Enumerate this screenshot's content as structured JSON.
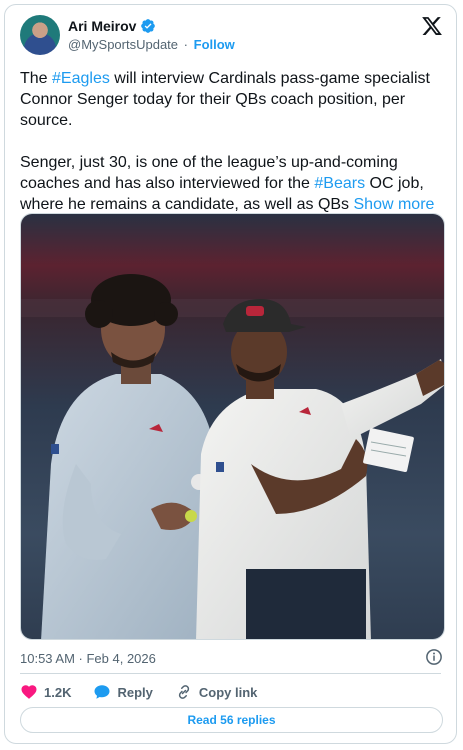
{
  "author": {
    "name": "Ari Meirov",
    "handle": "@MySportsUpdate",
    "separator": "·",
    "follow_label": "Follow"
  },
  "tweet": {
    "p1": {
      "t1": "The ",
      "hashtag": "#Eagles",
      "t2": " will interview Cardinals pass-game specialist Connor Senger today for their QBs coach position, per source."
    },
    "p2": {
      "t1": "Senger, just 30, is one of the league’s up-and-coming coaches and has also interviewed for the ",
      "hashtag": "#Bears",
      "t2": " OC job, where he remains a candidate, as well as QBs ",
      "show_more": "Show more"
    },
    "timestamp": "10:53 AM · Feb 4, 2026"
  },
  "actions": {
    "likes": "1.2K",
    "reply_label": "Reply",
    "copy_label": "Copy link"
  },
  "read_replies_label": "Read 56 replies",
  "icons": {
    "verified": "verified-badge-icon",
    "brand": "x-logo-icon",
    "info": "info-icon",
    "like": "heart-icon",
    "reply": "speech-bubble-icon",
    "copy": "link-icon"
  },
  "colors": {
    "accent": "#1d9bf0",
    "like": "#f91880",
    "text": "#0f1419",
    "muted": "#536471",
    "border": "#cfd9de"
  }
}
